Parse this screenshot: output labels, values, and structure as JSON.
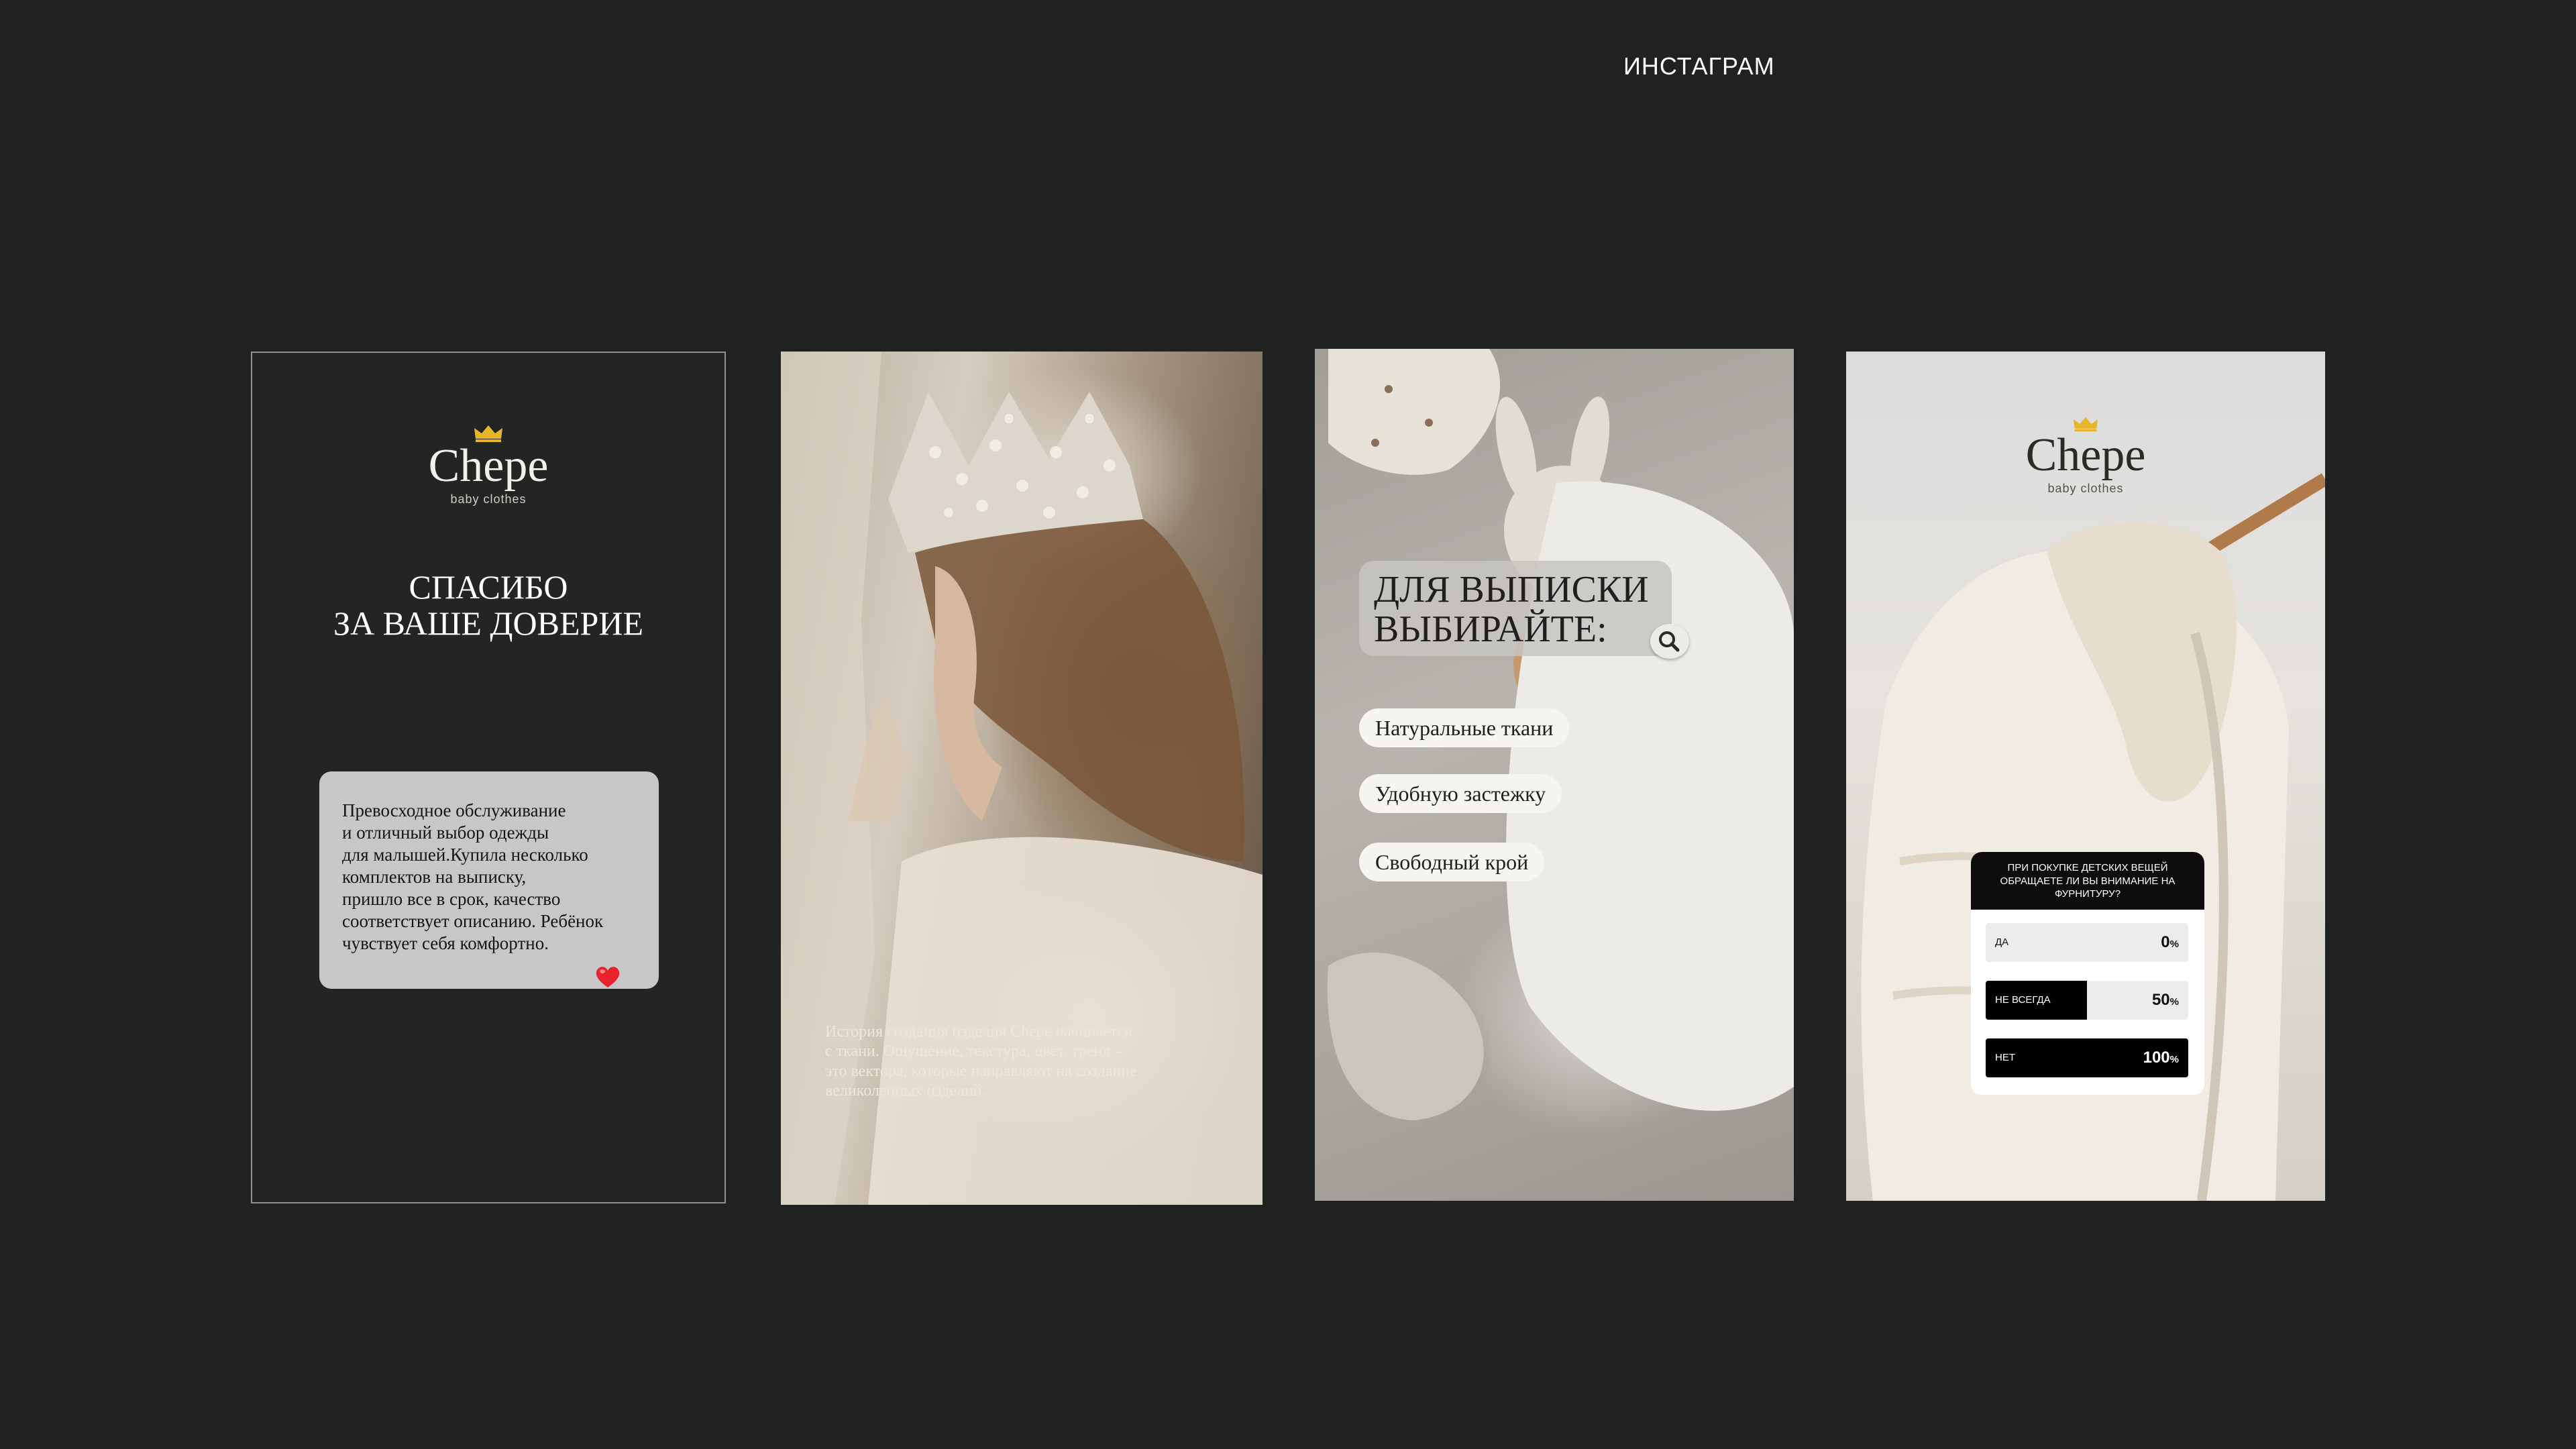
{
  "header": {
    "title": "ИНСТАГРАМ"
  },
  "brand": {
    "name": "Chepe",
    "tagline": "baby clothes",
    "crown_color": "#e8b42a"
  },
  "story1": {
    "heading_line1": "СПАСИБО",
    "heading_line2": "ЗА ВАШЕ ДОВЕРИЕ",
    "review_lines": [
      "Превосходное обслуживание",
      "и отличный выбор одежды",
      "для малышей.Купила несколько",
      "комплектов на выписку,",
      "пришло все в срок, качество",
      "соответствует описанию. Ребёнок",
      "чувствует себя комфортно."
    ],
    "reaction_icon": "heart-icon"
  },
  "story2": {
    "caption_lines": [
      "История создания изделия Chepe начинается",
      "с ткани. Ощущение, текстура, цвет, тренд –",
      "это вектора, которые направляют на создание",
      "великолепных изделий."
    ]
  },
  "story3": {
    "title_line1": "ДЛЯ ВЫПИСКИ",
    "title_line2": "ВЫБИРАЙТЕ:",
    "badge_icon": "magnifier-icon",
    "options": [
      "Натуральные ткани",
      "Удобную застежку",
      "Свободный крой"
    ]
  },
  "story4": {
    "poll": {
      "question_lines": [
        "ПРИ ПОКУПКЕ ДЕТСКИХ ВЕЩЕЙ",
        "ОБРАЩАЕТЕ ЛИ ВЫ ВНИМАНИЕ НА",
        "ФУРНИТУРУ?"
      ],
      "percent_sign": "%",
      "options": [
        {
          "label": "ДА",
          "value": "0",
          "fill_percent": 0
        },
        {
          "label": "НЕ ВСЕГДА",
          "value": "50",
          "fill_percent": 50
        },
        {
          "label": "НЕТ",
          "value": "100",
          "fill_percent": 100
        }
      ]
    }
  }
}
